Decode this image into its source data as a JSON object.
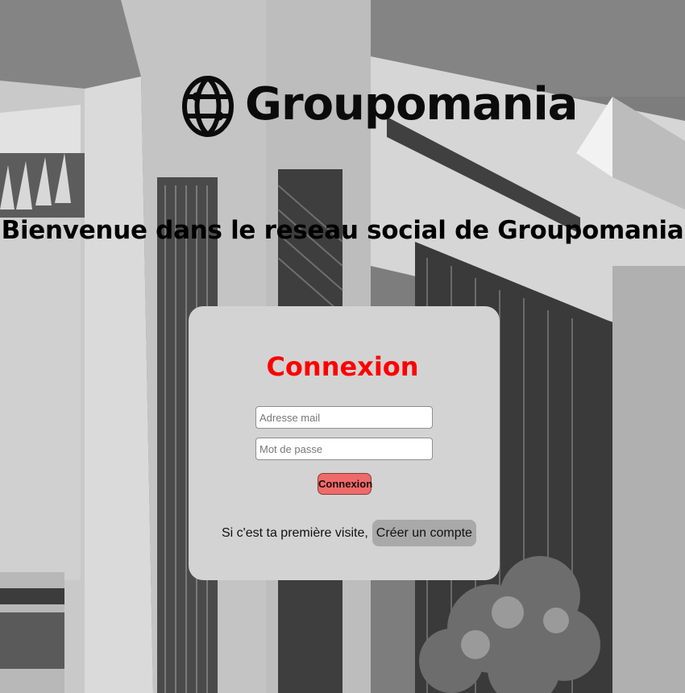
{
  "brand": {
    "logo_icon": "globe-icon",
    "name": "Groupomania"
  },
  "welcome": {
    "heading": "Bienvenue dans le reseau social de Groupomania"
  },
  "login": {
    "title": "Connexion",
    "email_placeholder": "Adresse mail",
    "password_placeholder": "Mot de passe",
    "submit_label": "Connexion"
  },
  "signup": {
    "prompt": "Si c'est ta première visite,",
    "button_label": "Créer un compte"
  },
  "colors": {
    "title": "#ff0000",
    "submit_button": "#ef6a6a",
    "card": "#d3d3d3",
    "signup_button": "#a9a9a9"
  }
}
